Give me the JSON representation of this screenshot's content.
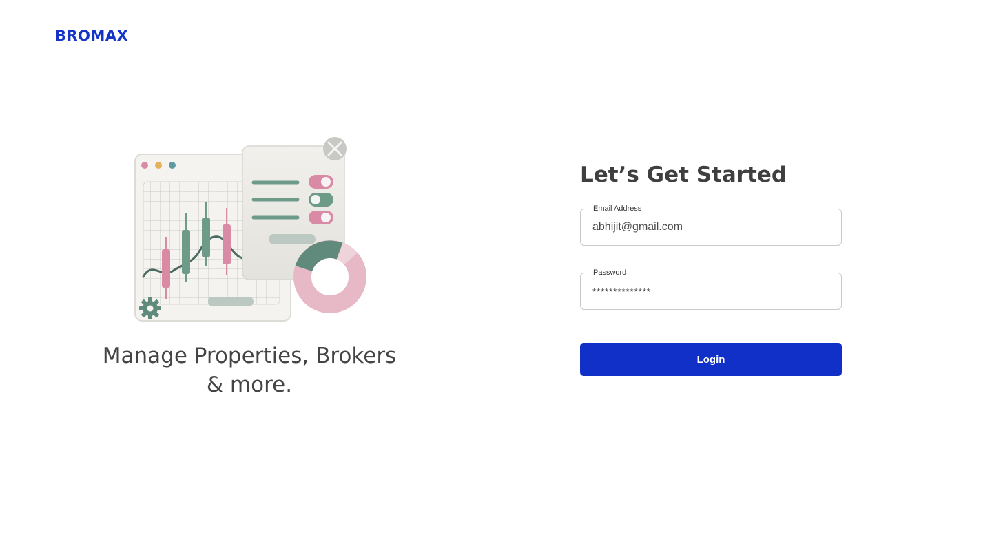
{
  "brand": {
    "name": "BROMAX",
    "color": "#1535c8"
  },
  "hero": {
    "illustration_icon": "trading-dashboard-illustration",
    "tagline_line1": "Manage Properties, Brokers",
    "tagline_line2": "& more."
  },
  "login_form": {
    "title": "Let’s Get Started",
    "email": {
      "label": "Email Address",
      "value": "abhijit@gmail.com"
    },
    "password": {
      "label": "Password",
      "value": "**************"
    },
    "submit_label": "Login",
    "accent_color": "#1030c8"
  }
}
